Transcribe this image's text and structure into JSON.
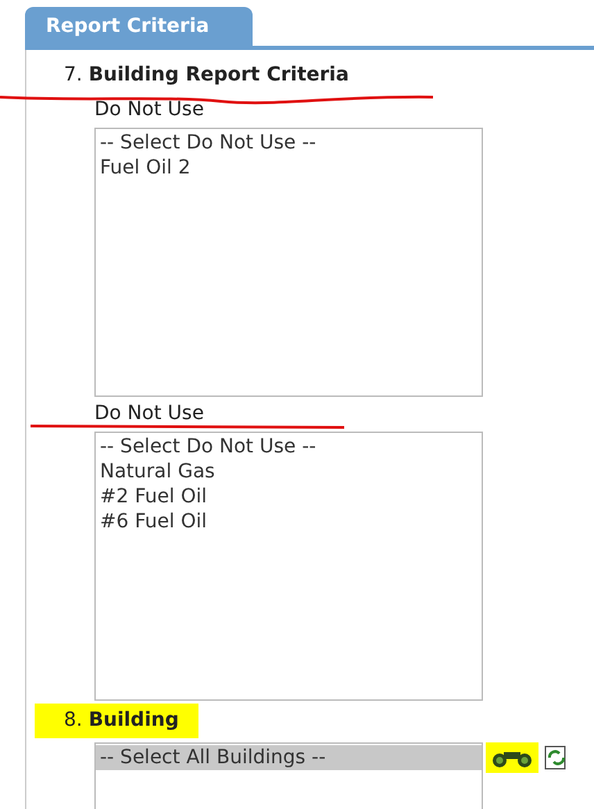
{
  "tab": {
    "label": "Report Criteria",
    "selected": true
  },
  "sections": [
    {
      "heading": "7. **Building Report Criteria**",
      "highlighted": false,
      "struck": true,
      "fields": [
        {
          "label": "Do Not Use",
          "struck": false,
          "options": [
            {
              "text": "-- Select Do Not Use --",
              "selected": false
            },
            {
              "text": "Fuel Oil 2",
              "selected": false
            }
          ]
        },
        {
          "label": "Do Not Use",
          "struck": true,
          "options": [
            {
              "text": "-- Select Do Not Use --",
              "selected": false
            },
            {
              "text": "Natural Gas",
              "selected": false
            },
            {
              "text": "#2 Fuel Oil",
              "selected": false
            },
            {
              "text": "#6 Fuel Oil",
              "selected": false
            }
          ]
        }
      ]
    },
    {
      "heading": "8. **Building**",
      "highlighted": true,
      "struck": false,
      "fields": [
        {
          "options": [
            {
              "text": "-- Select All Buildings --",
              "selected": true
            }
          ],
          "buttons": [
            {
              "kind": "search",
              "highlighted": true
            },
            {
              "kind": "refresh",
              "highlighted": false
            }
          ]
        }
      ]
    }
  ]
}
